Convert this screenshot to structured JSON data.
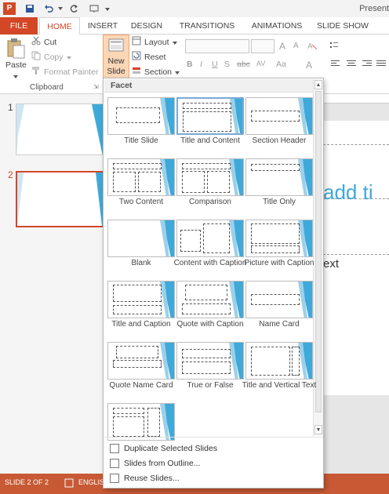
{
  "titlebar": {
    "app_icon": "P",
    "doc_title": "Present"
  },
  "tabs": {
    "file": "FILE",
    "home": "HOME",
    "insert": "INSERT",
    "design": "DESIGN",
    "transitions": "TRANSITIONS",
    "animations": "ANIMATIONS",
    "slideshow": "SLIDE SHOW"
  },
  "ribbon": {
    "paste": "Paste",
    "cut": "Cut",
    "copy": "Copy",
    "format_painter": "Format Painter",
    "clipboard_group": "Clipboard",
    "new_slide_line1": "New",
    "new_slide_line2": "Slide",
    "layout": "Layout",
    "reset": "Reset",
    "section": "Section",
    "font_bold": "B",
    "font_italic": "I",
    "font_underline": "U",
    "font_strike": "S",
    "font_abc": "abc",
    "font_av": "AV",
    "font_aa": "Aa",
    "font_a": "A"
  },
  "thumbnails": {
    "slide1_num": "1",
    "slide2_num": "2"
  },
  "slide_area": {
    "title_fragment": "add ti",
    "text_fragment": "ext"
  },
  "status": {
    "slide": "SLIDE 2 OF 2",
    "language": "ENGLIS"
  },
  "dropdown": {
    "header": "Facet",
    "layouts": [
      {
        "label": "Title Slide"
      },
      {
        "label": "Title and Content"
      },
      {
        "label": "Section Header"
      },
      {
        "label": "Two Content"
      },
      {
        "label": "Comparison"
      },
      {
        "label": "Title Only"
      },
      {
        "label": "Blank"
      },
      {
        "label": "Content with Caption"
      },
      {
        "label": "Picture with Caption"
      },
      {
        "label": "Title and Caption"
      },
      {
        "label": "Quote with Caption"
      },
      {
        "label": "Name Card"
      },
      {
        "label": "Quote Name Card"
      },
      {
        "label": "True or False"
      },
      {
        "label": "Title and Vertical Text"
      },
      {
        "label": ""
      }
    ],
    "commands": {
      "duplicate": "Duplicate Selected Slides",
      "outline": "Slides from Outline...",
      "reuse": "Reuse Slides..."
    }
  },
  "colors": {
    "accent": "#d24726",
    "facet_blue": "#3fa9d9",
    "selected_border": "#7aa9d6"
  }
}
